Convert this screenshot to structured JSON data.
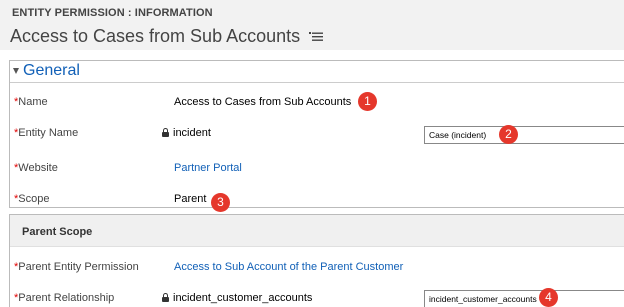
{
  "header": {
    "entity_type": "ENTITY PERMISSION : INFORMATION",
    "record_title": "Access to Cases from Sub Accounts"
  },
  "general_section": {
    "title": "General",
    "fields": [
      {
        "label": "Name",
        "required_marker": "*",
        "value": "Access to Cases from Sub Accounts",
        "callout": "1"
      },
      {
        "label": "Entity Name",
        "required_marker": "*",
        "value": "incident",
        "locked": true,
        "lookup_value": "Case (incident)",
        "callout": "2"
      },
      {
        "label": "Website",
        "required_marker": "*",
        "value": "Partner Portal",
        "is_link": true
      },
      {
        "label": "Scope",
        "required_marker": "*",
        "value": "Parent",
        "callout": "3"
      }
    ]
  },
  "parent_scope_section": {
    "title": "Parent Scope",
    "fields": [
      {
        "label": "Parent Entity Permission",
        "required_marker": "*",
        "value": "Access to Sub Account of the Parent Customer",
        "is_link": true
      },
      {
        "label": "Parent Relationship",
        "required_marker": "*",
        "value": "incident_customer_accounts",
        "locked": true,
        "lookup_value": "incident_customer_accounts",
        "callout": "4"
      }
    ]
  },
  "colors": {
    "header_bg": "#f2f2f2",
    "link": "#1160b7",
    "required": "#e00000",
    "callout_bg": "#e5372b"
  }
}
